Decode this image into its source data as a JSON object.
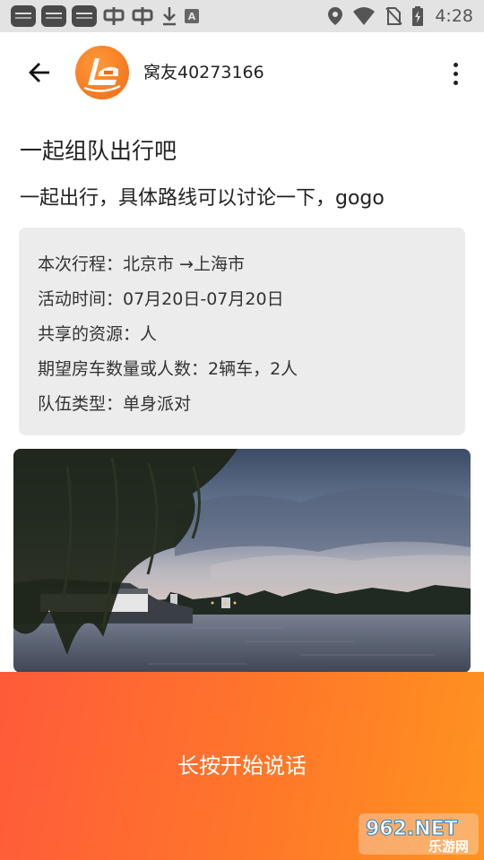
{
  "status_bar": {
    "time": "4:28",
    "icons": [
      "app-icon",
      "app-icon",
      "app-icon",
      "bug-icon",
      "bug-icon",
      "download-icon",
      "a-icon",
      "location-icon",
      "wifi-icon",
      "no-sim-icon",
      "battery-icon"
    ]
  },
  "toolbar": {
    "user_name": "窝友40273166",
    "back_icon": "arrow-left-icon",
    "more_icon": "more-vertical-icon"
  },
  "post": {
    "title": "一起组队出行吧",
    "description": "一起出行，具体路线可以讨论一下，gogo"
  },
  "info": {
    "route": "本次行程：北京市 →上海市",
    "time": "活动时间：07月20日-07月20日",
    "resource": "共享的资源：人",
    "expected": "期望房车数量或人数：2辆车，2人",
    "team_type": "队伍类型：单身派对"
  },
  "voice": {
    "label": "长按开始说话"
  },
  "watermark": {
    "brand": "962.NET",
    "site": "乐游网"
  },
  "colors": {
    "voice_start": "#ff5a3a",
    "voice_end": "#ff9320",
    "card_bg": "#ececec",
    "avatar": "#f06a12"
  }
}
